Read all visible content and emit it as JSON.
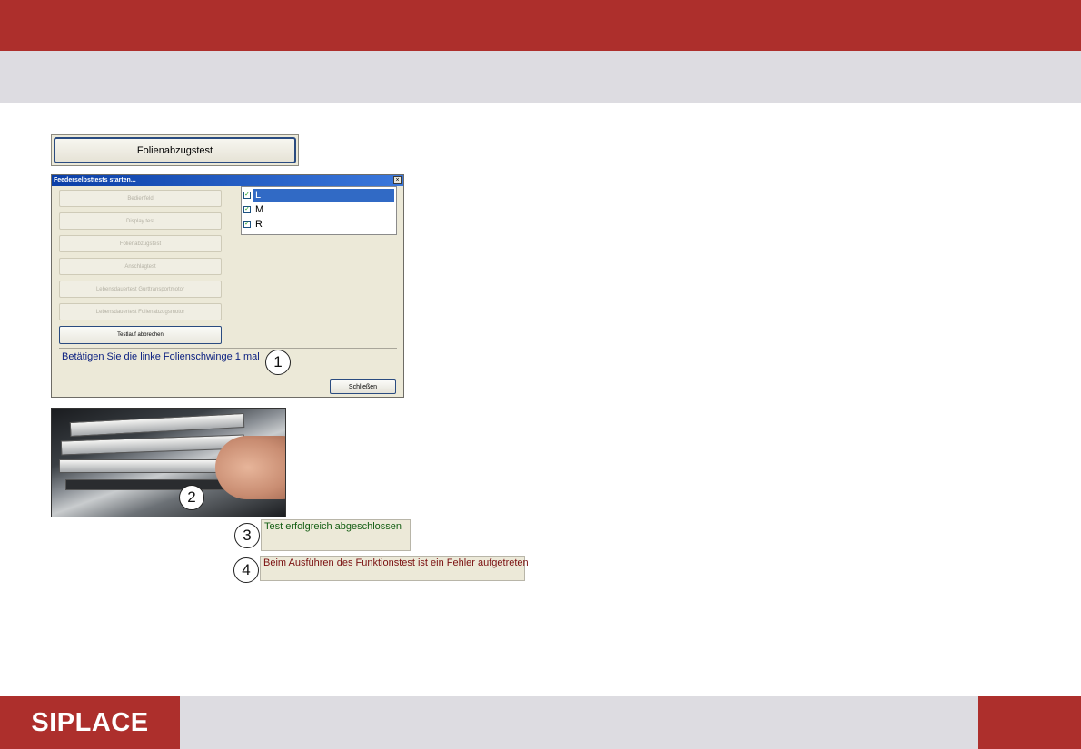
{
  "footer": {
    "logo_text": "SIPLACE"
  },
  "main_button": {
    "label": "Folienabzugstest"
  },
  "dialog": {
    "title": "Feederselbsttests starten...",
    "close_symbol": "×",
    "buttons": [
      {
        "label": "Bedienfeld",
        "enabled": false
      },
      {
        "label": "Display test",
        "enabled": false
      },
      {
        "label": "Folienabzugstest",
        "enabled": false
      },
      {
        "label": "Anschlagtest",
        "enabled": false
      },
      {
        "label": "Lebensdauertest Gurttransportmotor",
        "enabled": false
      },
      {
        "label": "Lebensdauertest Folienabzugsmotor",
        "enabled": false
      },
      {
        "label": "Testlauf abbrechen",
        "enabled": true
      }
    ],
    "list": [
      {
        "label": "L",
        "checked": true,
        "selected": true
      },
      {
        "label": "M",
        "checked": true,
        "selected": false
      },
      {
        "label": "R",
        "checked": true,
        "selected": false
      }
    ],
    "status_text": "Betätigen Sie die linke Folienschwinge 1 mal",
    "close_button": "Schließen"
  },
  "callouts": [
    "1",
    "2",
    "3",
    "4"
  ],
  "messages": {
    "success": "Test erfolgreich abgeschlossen",
    "error": "Beim Ausführen des Funktionstest ist ein Fehler aufgetreten"
  },
  "colors": {
    "brand_red": "#ad2f2c",
    "band_gray": "#dddce1",
    "dialog_bg": "#ece9d8"
  },
  "icons": {
    "checkbox": "checkbox-checked-icon",
    "close": "close-icon"
  }
}
